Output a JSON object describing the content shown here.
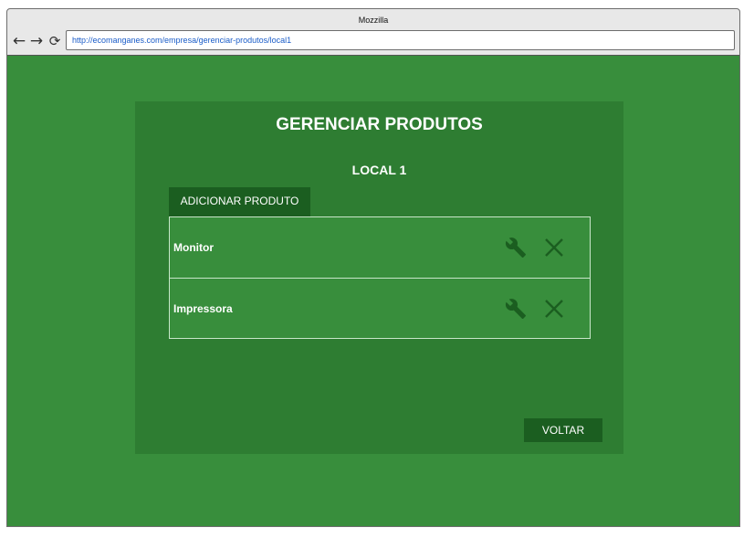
{
  "browser": {
    "title": "Mozzilla",
    "url": "http://ecomanganes.com/empresa/gerenciar-produtos/local1",
    "nav": {
      "back": "←",
      "forward": "→",
      "reload": "⟳"
    }
  },
  "page": {
    "title": "GERENCIAR PRODUTOS",
    "subtitle": "LOCAL 1",
    "add_button": "ADICIONAR PRODUTO",
    "back_button": "VOLTAR",
    "products": [
      {
        "name": "Monitor",
        "edit_icon": "wrench-icon",
        "delete_icon": "close-icon"
      },
      {
        "name": "Impressora",
        "edit_icon": "wrench-icon",
        "delete_icon": "close-icon"
      }
    ]
  },
  "colors": {
    "background": "#388e3c",
    "panel": "#2e7d32",
    "button": "#1b5e20",
    "icon": "#1b5e20",
    "text": "#ffffff"
  }
}
